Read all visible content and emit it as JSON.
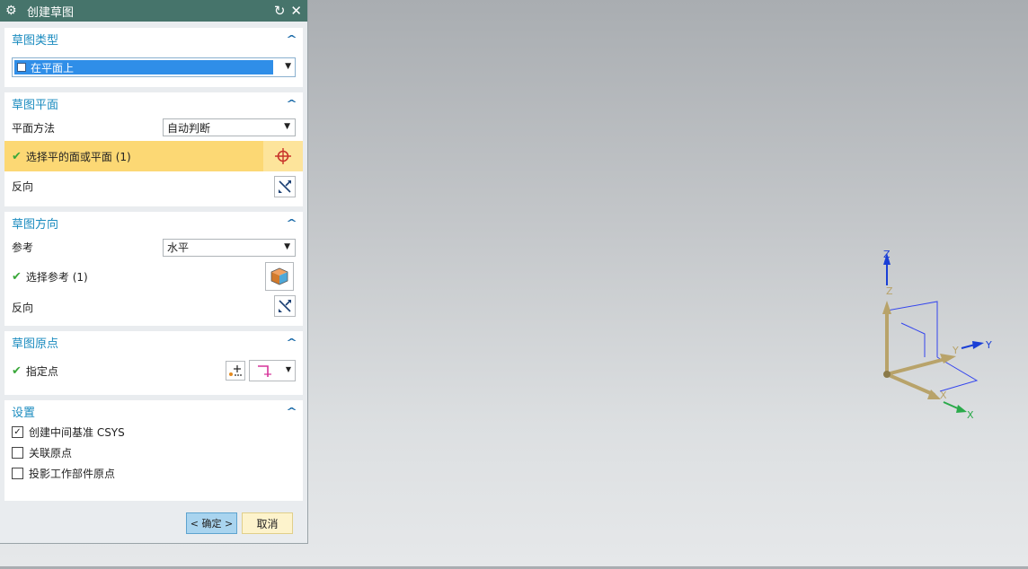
{
  "dialog": {
    "title": "创建草图",
    "sections": {
      "type": {
        "title": "草图类型",
        "value": "在平面上"
      },
      "plane": {
        "title": "草图平面",
        "method_label": "平面方法",
        "method_value": "自动判断",
        "select_label": "选择平的面或平面 (1)",
        "reverse_label": "反向"
      },
      "orientation": {
        "title": "草图方向",
        "reference_label": "参考",
        "reference_value": "水平",
        "select_label": "选择参考 (1)",
        "reverse_label": "反向"
      },
      "origin": {
        "title": "草图原点",
        "point_label": "指定点"
      },
      "settings": {
        "title": "设置",
        "options": [
          {
            "label": "创建中间基准 CSYS",
            "checked": true
          },
          {
            "label": "关联原点",
            "checked": false
          },
          {
            "label": "投影工作部件原点",
            "checked": false
          }
        ]
      }
    },
    "buttons": {
      "ok": "< 确定 >",
      "cancel": "取消"
    }
  },
  "viewport": {
    "triad": {
      "z_label": "Z",
      "y_label": "Y",
      "x_label": "X",
      "z_small": "Z",
      "y_small": "Y",
      "x_small": "X"
    }
  },
  "colors": {
    "title_bar": "#46746b",
    "section_title": "#1a8bbf",
    "highlight_row": "#fcd874",
    "ok_button": "#a9d4ef",
    "cancel_button": "#fdf3cc"
  }
}
